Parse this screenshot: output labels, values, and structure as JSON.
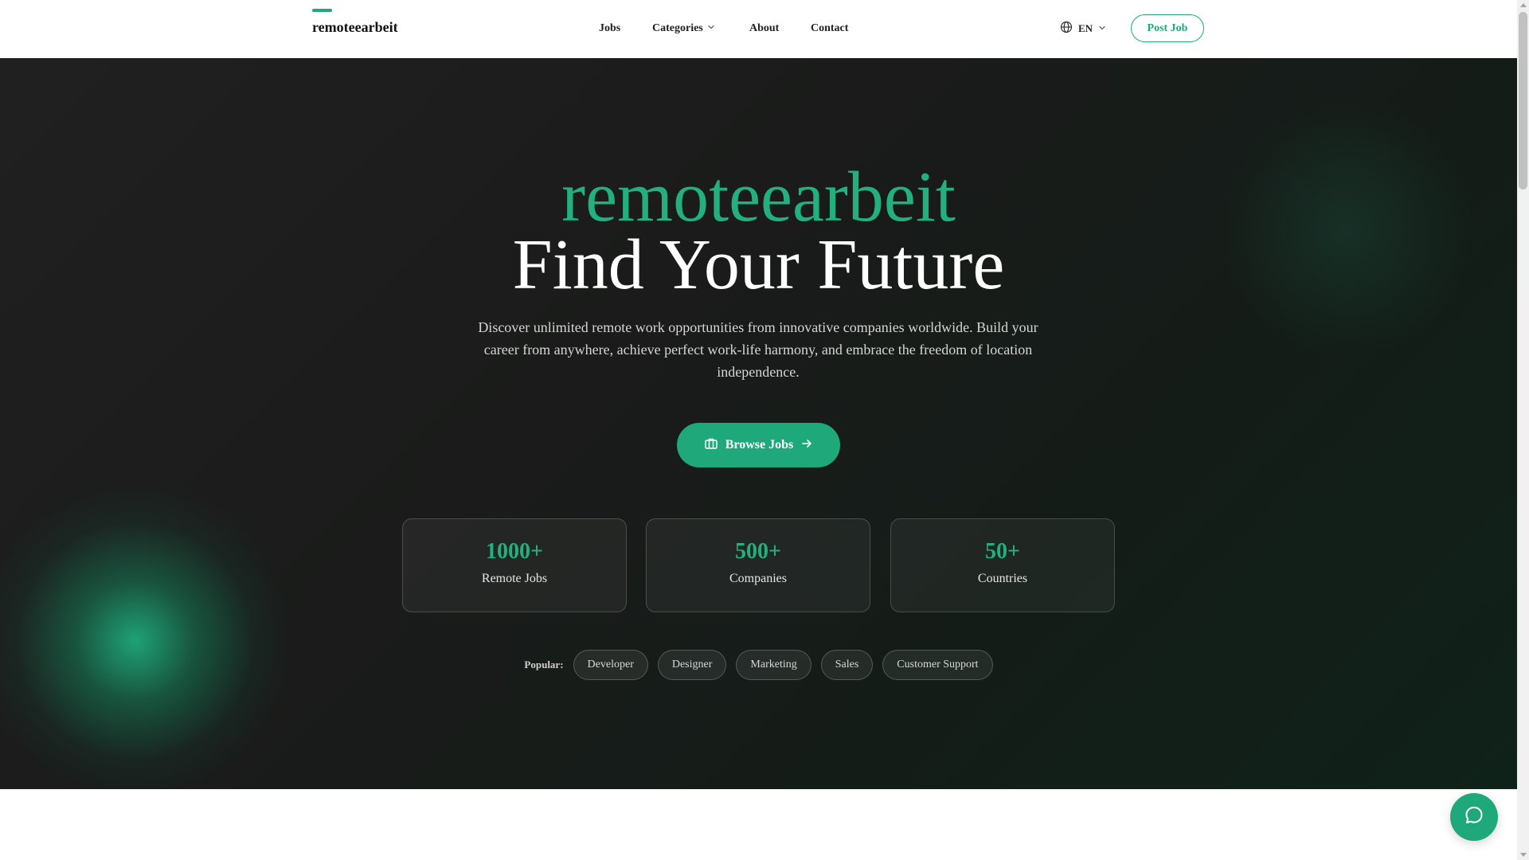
{
  "header": {
    "logo": "remoteearbeit",
    "nav": {
      "jobs": "Jobs",
      "categories": "Categories",
      "about": "About",
      "contact": "Contact"
    },
    "language": "EN",
    "post_job": "Post Job"
  },
  "hero": {
    "title_brand": "remoteearbeit",
    "title_main": "Find Your Future",
    "description": "Discover unlimited remote work opportunities from innovative companies worldwide. Build your career from anywhere, achieve perfect work-life harmony, and embrace the freedom of location independence.",
    "browse_button": "Browse Jobs",
    "stats": [
      {
        "value": "1000+",
        "label": "Remote Jobs"
      },
      {
        "value": "500+",
        "label": "Companies"
      },
      {
        "value": "50+",
        "label": "Countries"
      }
    ],
    "popular_label": "Popular:",
    "popular_tags": [
      "Developer",
      "Designer",
      "Marketing",
      "Sales",
      "Customer Support"
    ]
  },
  "icons": {
    "language": "globe-icon",
    "categories_dropdown": "chevron-down-icon",
    "browse": "briefcase-icon",
    "browse_arrow": "arrow-right-icon",
    "chat": "chat-bubble-icon"
  },
  "colors": {
    "accent": "#1fa97a",
    "hero_bg": "#1a1b1a"
  }
}
